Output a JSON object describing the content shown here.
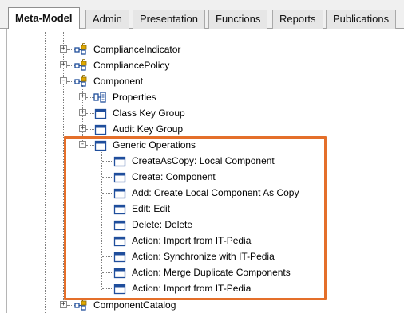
{
  "tabs": [
    {
      "label": "Meta-Model",
      "active": true
    },
    {
      "label": "Admin",
      "active": false
    },
    {
      "label": "Presentation",
      "active": false
    },
    {
      "label": "Functions",
      "active": false
    },
    {
      "label": "Reports",
      "active": false
    },
    {
      "label": "Publications",
      "active": false
    }
  ],
  "tree": {
    "compliance_indicator": {
      "label": "ComplianceIndicator",
      "icon": "class-lock-icon",
      "expander": "+"
    },
    "compliance_policy": {
      "label": "CompliancePolicy",
      "icon": "class-lock-icon",
      "expander": "+"
    },
    "component": {
      "label": "Component",
      "icon": "class-lock-icon",
      "expander": "-"
    },
    "properties": {
      "label": "Properties",
      "icon": "properties-icon",
      "expander": "+"
    },
    "class_key_group": {
      "label": "Class Key Group",
      "icon": "window-icon",
      "expander": "+"
    },
    "audit_key_group": {
      "label": "Audit Key Group",
      "icon": "window-icon",
      "expander": "+"
    },
    "generic_operations": {
      "label": "Generic Operations",
      "icon": "window-icon",
      "expander": "-"
    },
    "operations": [
      {
        "label": "CreateAsCopy: Local Component",
        "icon": "window-icon"
      },
      {
        "label": "Create: Component",
        "icon": "window-icon"
      },
      {
        "label": "Add: Create Local Component As Copy",
        "icon": "window-icon"
      },
      {
        "label": "Edit: Edit",
        "icon": "window-icon"
      },
      {
        "label": "Delete: Delete",
        "icon": "window-icon"
      },
      {
        "label": "Action: Import from IT-Pedia",
        "icon": "window-icon"
      },
      {
        "label": "Action: Synchronize with IT-Pedia",
        "icon": "window-icon"
      },
      {
        "label": "Action: Merge Duplicate Components",
        "icon": "window-icon"
      },
      {
        "label": "Action: Import from IT-Pedia",
        "icon": "window-icon"
      }
    ],
    "component_catalog": {
      "label": "ComponentCatalog",
      "icon": "class-lock-icon",
      "expander": "+"
    }
  },
  "colors": {
    "highlight": "#e46f2a",
    "node_icon_blue": "#1f4e9c",
    "lock_gold": "#e0a800"
  }
}
